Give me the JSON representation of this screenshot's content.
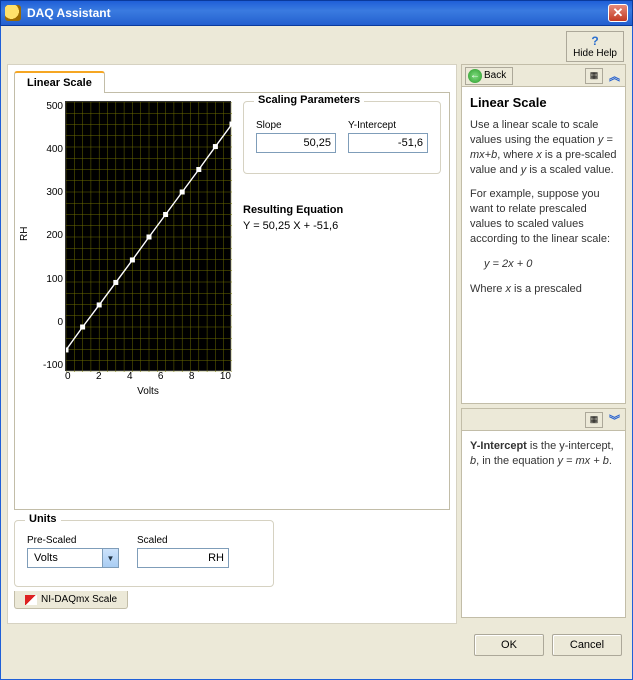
{
  "window": {
    "title": "DAQ Assistant",
    "hide_help": "Hide Help"
  },
  "tab": {
    "label": "Linear Scale"
  },
  "chart_data": {
    "type": "line",
    "title": "",
    "xlabel": "Volts",
    "ylabel": "RH",
    "xlim": [
      0,
      10
    ],
    "ylim": [
      -100,
      500
    ],
    "xticks": [
      0,
      2,
      4,
      6,
      8,
      10
    ],
    "yticks": [
      -100,
      0,
      100,
      200,
      300,
      400,
      500
    ],
    "x": [
      0,
      1,
      2,
      3,
      4,
      5,
      6,
      7,
      8,
      9,
      10
    ],
    "values": [
      -51,
      0,
      49,
      99,
      149,
      200,
      250,
      300,
      350,
      401,
      451
    ]
  },
  "scaling": {
    "legend": "Scaling Parameters",
    "slope_label": "Slope",
    "slope_value": "50,25",
    "yint_label": "Y-Intercept",
    "yint_value": "-51,6"
  },
  "equation": {
    "title": "Resulting Equation",
    "text": "Y = 50,25 X + -51,6"
  },
  "units": {
    "legend": "Units",
    "prescaled_label": "Pre-Scaled",
    "prescaled_value": "Volts",
    "scaled_label": "Scaled",
    "scaled_value": "RH"
  },
  "daqmx_tab": "NI-DAQmx Scale",
  "help_top": {
    "back": "Back",
    "title": "Linear Scale",
    "p1a": "Use a linear scale to scale values using the equation ",
    "p1eq": "y = mx+b",
    "p1b": ", where ",
    "p1x": "x",
    "p1c": " is a pre-scaled value and ",
    "p1y": "y",
    "p1d": " is a scaled value.",
    "p2": "For example, suppose you want to relate prescaled values to scaled values according to the linear scale:",
    "eq": "y = 2x + 0",
    "p3a": "Where ",
    "p3x": "x",
    "p3b": " is a prescaled"
  },
  "help_bottom": {
    "p1a": "Y-Intercept",
    "p1b": " is the y-intercept, ",
    "p1c": "b",
    "p1d": ", in the equation ",
    "p1e": "y = mx + b",
    "p1f": "."
  },
  "buttons": {
    "ok": "OK",
    "cancel": "Cancel"
  }
}
